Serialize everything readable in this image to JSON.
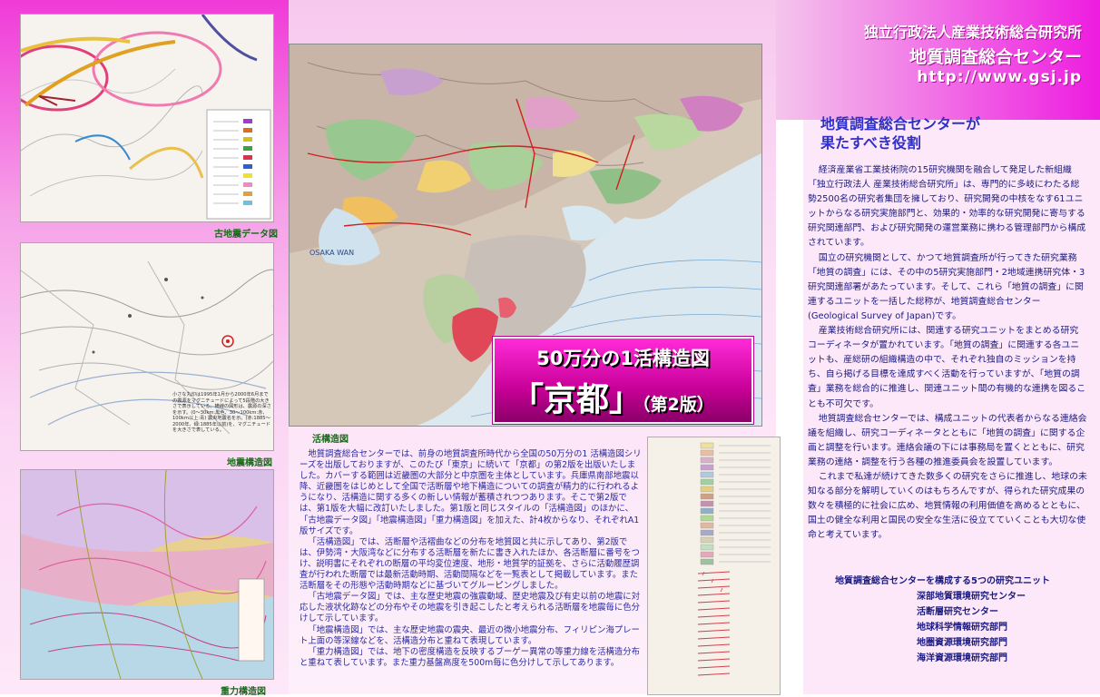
{
  "header": {
    "organization": "独立行政法人産業技術総合研究所",
    "center_name": "地質調査総合センター",
    "url": "http://www.gsj.jp"
  },
  "figures": {
    "paleo_seismic": {
      "caption": "古地震データ図"
    },
    "seismotectonic": {
      "caption": "地震構造図",
      "note": "小さな丸印は1995年1月から2000年6月までの震源をマグニチュードによって5段階の大きさで表示している。横線の図形は、震源の深さを示す。(0〜30km:黒色、30〜100km:赤、100km以上:青) 震央地震名を示。(赤:1885〜2000年、緑:1885年以前)を、マグニチュードを大きさで表している。"
    },
    "active_tectonic": {
      "caption": "活構造図"
    },
    "gravity": {
      "caption": "重力構造図"
    }
  },
  "map_title": {
    "line1": "50万分の1活構造図",
    "line2": "「京都」",
    "edition": "（第2版）"
  },
  "map_labels": {
    "bay": "OSAKA WAN"
  },
  "description": [
    "地質調査総合センターでは、前身の地質調査所時代から全国の50万分の1 活構造図シリーズを出版しておりますが、このたび「東京」に続いて「京都」の第2版を出版いたしました。カバーする範囲は近畿圏の大部分と中京圏を主体としています。兵庫県南部地震以降、近畿圏をはじめとして全国で活断層や地下構造についての調査が精力的に行われるようになり、活構造に関する多くの新しい情報が蓄積されつつあります。そこで第2版では、第1版を大幅に改訂いたしました。第1版と同じスタイルの「活構造図」のほかに、「古地震データ図」「地震構造図」「重力構造図」を加えた、計4枚からなり、それぞれA1版サイズです。",
    "「活構造図」では、活断層や活褶曲などの分布を地質図と共に示してあり、第2版では、伊勢湾・大阪湾などに分布する活断層を新たに書き入れたほか、各活断層に番号をつけ、説明書にそれぞれの断層の平均変位速度、地形・地質学的証拠を、さらに活動履歴調査が行われた断層では最新活動時期、活動間隔などを一覧表として掲載しています。また活断層をその形態や活動時期などに基づいてグルーピングしました。",
    "「古地震データ図」では、主な歴史地震の強震動域、歴史地震及び有史以前の地震に対応した液状化跡などの分布やその地震を引き起こしたと考えられる活断層を地震毎に色分けして示しています。",
    "「地震構造図」では、主な歴史地震の震央、最近の微小地震分布、フィリピン海プレート上面の等深線などを、活構造分布と重ねて表現しています。",
    "「重力構造図」では、地下の密度構造を反映するブーゲー異常の等重力線を活構造分布と重ねて表しています。また重力基盤高度を500m毎に色分けして示してあります。"
  ],
  "role": {
    "title_line1": "地質調査総合センターが",
    "title_line2": "果たすべき役割",
    "paragraphs": [
      "経済産業省工業技術院の15研究機関を融合して発足した新組織「独立行政法人 産業技術総合研究所」は、専門的に多岐にわたる総勢2500名の研究者集団を擁しており、研究開発の中核をなす61ユニットからなる研究実施部門と、効果的・効率的な研究開発に寄与する研究関連部門、および研究開発の運営業務に携わる管理部門から構成されています。",
      "国立の研究機関として、かつて地質調査所が行ってきた研究業務「地質の調査」には、その中の5研究実施部門・2地域連携研究体・3研究関連部署があたっています。そして、これら「地質の調査」に関連するユニットを一括した総称が、地質調査総合センター(Geological Survey of Japan)です。",
      "産業技術総合研究所には、関連する研究ユニットをまとめる研究コーディネータが置かれています。「地質の調査」に関連する各ユニットも、産総研の組織構造の中で、それぞれ独自のミッションを持ち、自ら掲げる目標を達成すべく活動を行っていますが、「地質の調査」業務を総合的に推進し、関連ユニット間の有機的な連携を図ることも不可欠です。",
      "地質調査総合センターでは、構成ユニットの代表者からなる連絡会議を組織し、研究コーディネータとともに「地質の調査」に関する企画と調整を行います。連絡会議の下には事務局を置くとともに、研究業務の連絡・調整を行う各種の推進委員会を設置しています。",
      "これまで私達が続けてきた数多くの研究をさらに推進し、地球の未知なる部分を解明していくのはもちろんですが、得られた研究成果の数々を積極的に社会に広め、地質情報の利用価値を高めるとともに、国土の健全な利用と国民の安全な生活に役立てていくことも大切な使命と考えています。"
    ]
  },
  "units": {
    "title": "地質調査総合センターを構成する5つの研究ユニット",
    "items": [
      "深部地質環境研究センター",
      "活断層研究センター",
      "地球科学情報研究部門",
      "地圏資源環境研究部門",
      "海洋資源環境研究部門"
    ]
  },
  "colors": {
    "accent_magenta": "#ee1ce0",
    "title_text": "#3030c8",
    "body_text": "#1a1a80",
    "caption_green": "#1a6a1a"
  }
}
